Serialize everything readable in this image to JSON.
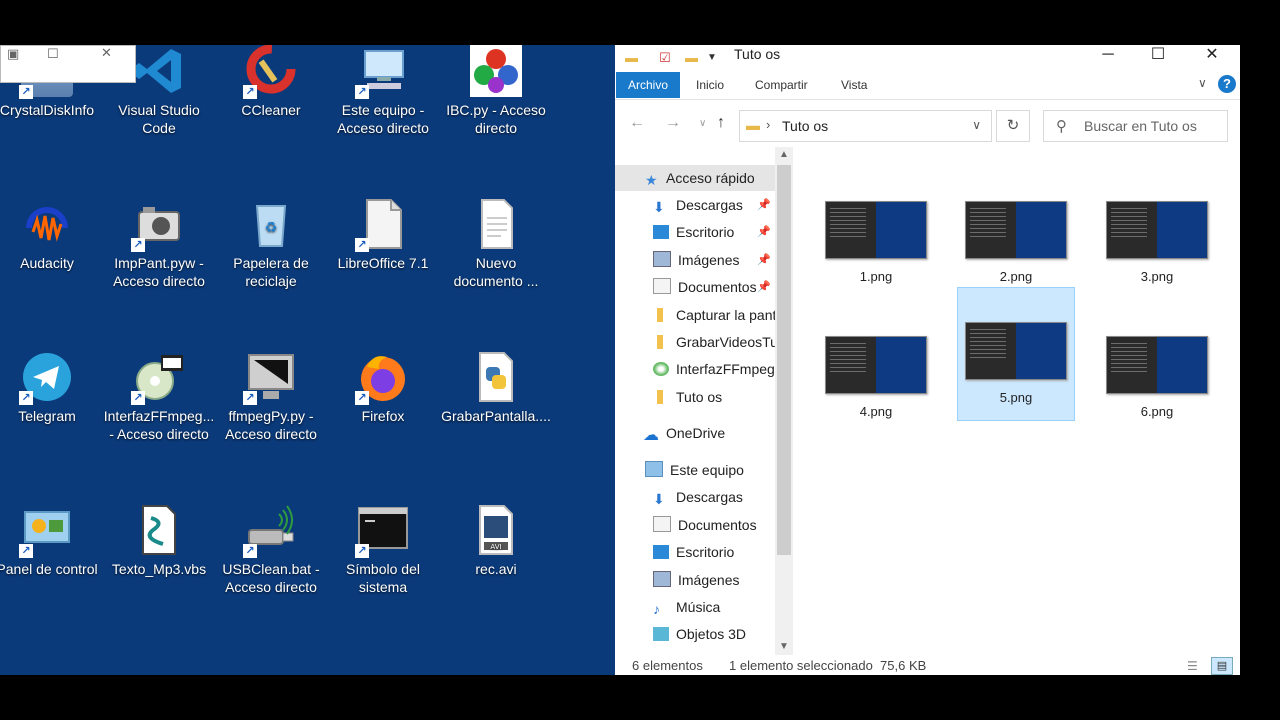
{
  "desktop": {
    "icons": [
      {
        "label": "CrystalDiskInfo"
      },
      {
        "label": "Visual Studio Code"
      },
      {
        "label": "CCleaner"
      },
      {
        "label": "Este equipo - Acceso directo"
      },
      {
        "label": "IBC.py - Acceso directo"
      },
      {
        "label": "Audacity"
      },
      {
        "label": "ImpPant.pyw - Acceso directo"
      },
      {
        "label": "Papelera de reciclaje"
      },
      {
        "label": "LibreOffice 7.1"
      },
      {
        "label": "Nuevo documento ..."
      },
      {
        "label": "Telegram"
      },
      {
        "label": "InterfazFFmpeg... - Acceso directo"
      },
      {
        "label": "ffmpegPy.py - Acceso directo"
      },
      {
        "label": "Firefox"
      },
      {
        "label": "GrabarPantalla...."
      },
      {
        "label": "Panel de control"
      },
      {
        "label": "Texto_Mp3.vbs"
      },
      {
        "label": "USBClean.bat - Acceso directo"
      },
      {
        "label": "Símbolo del sistema"
      },
      {
        "label": "rec.avi"
      }
    ]
  },
  "explorer": {
    "title": "Tuto os",
    "ribbon_tabs": [
      "Archivo",
      "Inicio",
      "Compartir",
      "Vista"
    ],
    "address": "Tuto os",
    "search_placeholder": "Buscar en Tuto os",
    "nav": [
      {
        "label": "Acceso rápido"
      },
      {
        "label": "Descargas"
      },
      {
        "label": "Escritorio"
      },
      {
        "label": "Imágenes"
      },
      {
        "label": "Documentos"
      },
      {
        "label": "Capturar la panta"
      },
      {
        "label": "GrabarVideosTut"
      },
      {
        "label": "InterfazFFmpegF"
      },
      {
        "label": "Tuto os"
      },
      {
        "label": "OneDrive"
      },
      {
        "label": "Este equipo"
      },
      {
        "label": "Descargas"
      },
      {
        "label": "Documentos"
      },
      {
        "label": "Escritorio"
      },
      {
        "label": "Imágenes"
      },
      {
        "label": "Música"
      },
      {
        "label": "Objetos 3D"
      }
    ],
    "files": [
      {
        "name": "1.png"
      },
      {
        "name": "2.png"
      },
      {
        "name": "3.png"
      },
      {
        "name": "4.png"
      },
      {
        "name": "5.png"
      },
      {
        "name": "6.png"
      }
    ],
    "status_count": "6 elementos",
    "status_selection": "1 elemento seleccionado  75,6 KB"
  },
  "colors": {
    "desktop_bg": "#0b3a7a",
    "accent": "#1979ca",
    "selection": "#cce8ff"
  }
}
